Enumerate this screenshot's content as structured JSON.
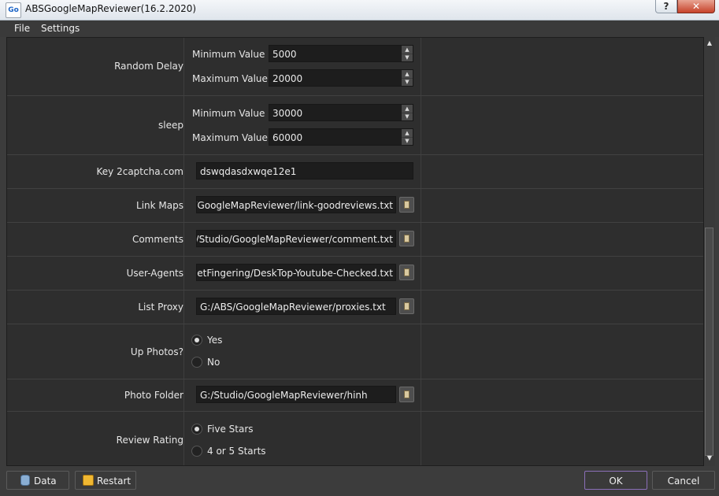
{
  "window": {
    "title": "ABSGoogleMapReviewer(16.2.2020)",
    "app_icon_text": "Go",
    "help": "?",
    "close": "✕"
  },
  "menu": [
    "File",
    "Settings"
  ],
  "settings": {
    "random_delay": {
      "label": "Random Delay",
      "min_label": "Minimum Value",
      "min_value": "5000",
      "max_label": "Maximum Value",
      "max_value": "20000"
    },
    "sleep": {
      "label": "sleep",
      "min_label": "Minimum Value",
      "min_value": "30000",
      "max_label": "Maximum Value",
      "max_value": "60000"
    },
    "key_2captcha": {
      "label": "Key 2captcha.com",
      "value": "dswqdasdxwqe12e1"
    },
    "link_maps": {
      "label": "Link Maps",
      "value": "o/GoogleMapReviewer/link-goodreviews.txt"
    },
    "comments": {
      "label": "Comments",
      "value": "G:/Studio/GoogleMapReviewer/comment.txt"
    },
    "user_agents": {
      "label": "User-Agents",
      "value": "GetFingering/DeskTop-Youtube-Checked.txt"
    },
    "list_proxy": {
      "label": "List Proxy",
      "value": "G:/ABS/GoogleMapReviewer/proxies.txt"
    },
    "up_photos": {
      "label": "Up Photos?",
      "options": [
        "Yes",
        "No"
      ],
      "selected": "Yes"
    },
    "photo_folder": {
      "label": "Photo Folder",
      "value": "G:/Studio/GoogleMapReviewer/hinh"
    },
    "review_rating": {
      "label": "Review Rating",
      "options": [
        "Five Stars",
        "4 or 5 Starts"
      ],
      "selected": "Five Stars"
    }
  },
  "buttons": {
    "data": "Data",
    "restart": "Restart",
    "ok": "OK",
    "cancel": "Cancel"
  },
  "icons": {
    "spin_up": "▲",
    "spin_down": "▼",
    "scroll_up": "▲",
    "scroll_down": "▼"
  }
}
